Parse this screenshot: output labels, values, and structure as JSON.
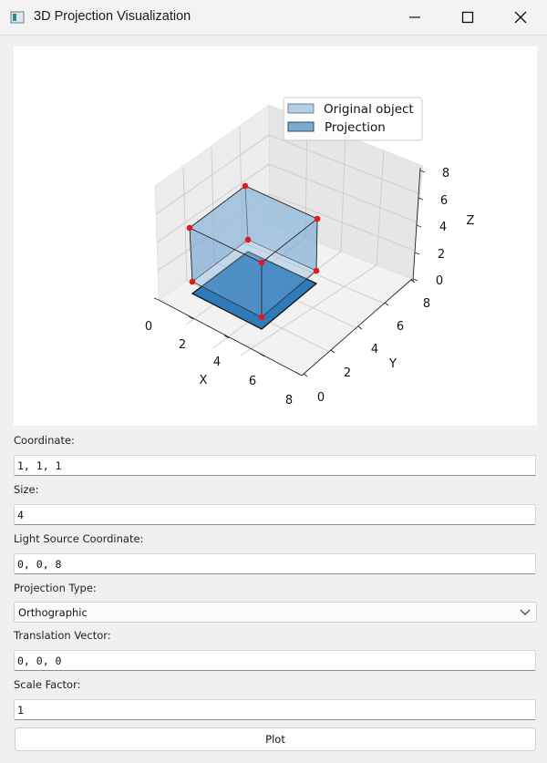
{
  "window": {
    "title": "3D Projection Visualization",
    "icons": {
      "app": "app-icon",
      "minimize": "minimize-icon",
      "maximize": "maximize-icon",
      "close": "close-icon"
    }
  },
  "plot": {
    "legend": {
      "original": "Original object",
      "projection": "Projection"
    },
    "axes": {
      "x": {
        "label": "X",
        "ticks": [
          "0",
          "2",
          "4",
          "6",
          "8"
        ]
      },
      "y": {
        "label": "Y",
        "ticks": [
          "0",
          "2",
          "4",
          "6",
          "8"
        ]
      },
      "z": {
        "label": "Z",
        "ticks": [
          "0",
          "2",
          "4",
          "6",
          "8"
        ]
      }
    }
  },
  "chart_data": {
    "type": "3d-projection",
    "legend_placement": "upper-right",
    "xlim": [
      0,
      8
    ],
    "ylim": [
      0,
      8
    ],
    "zlim": [
      0,
      8
    ],
    "grid": true,
    "series": [
      {
        "name": "Original object",
        "shape": "cube",
        "origin": [
          1,
          1,
          1
        ],
        "size": 4,
        "color": "#7fa9d0"
      },
      {
        "name": "Projection",
        "shape": "square",
        "plane": "z=0",
        "color": "#2f7ab8"
      }
    ],
    "vertex_color": "#e31a1c"
  },
  "form": {
    "coordinate": {
      "label": "Coordinate:",
      "value": "1, 1, 1"
    },
    "size": {
      "label": "Size:",
      "value": "4"
    },
    "light_source": {
      "label": "Light Source Coordinate:",
      "value": "0, 0, 8"
    },
    "projection_type": {
      "label": "Projection Type:",
      "value": "Orthographic"
    },
    "translation": {
      "label": "Translation Vector:",
      "value": "0, 0, 0"
    },
    "scale": {
      "label": "Scale Factor:",
      "value": "1"
    },
    "plot_button": "Plot"
  }
}
